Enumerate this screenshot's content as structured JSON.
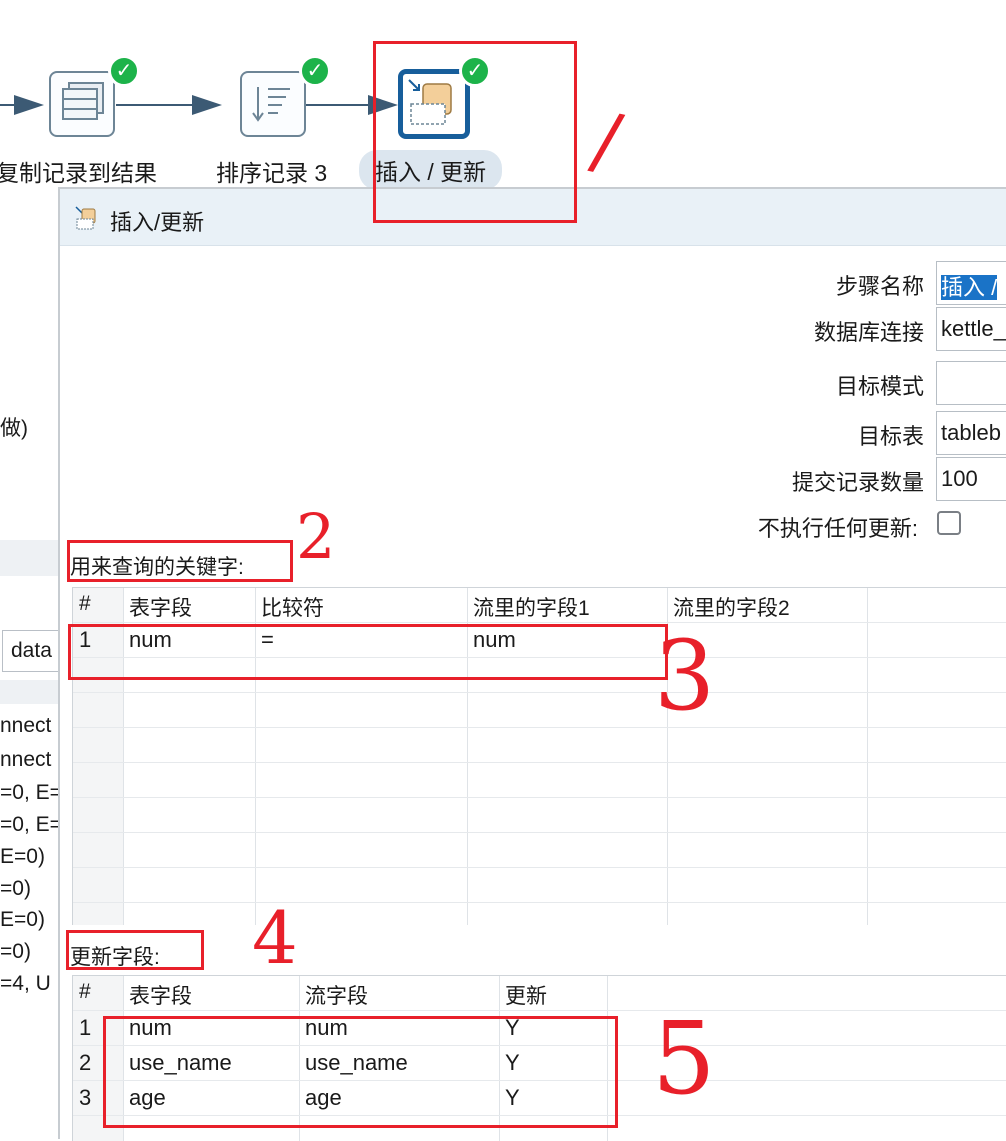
{
  "canvas": {
    "steps": [
      {
        "label": "复制记录到结果"
      },
      {
        "label": "排序记录 3"
      },
      {
        "label": "插入 / 更新"
      }
    ],
    "background_log": [
      "做)",
      "data",
      "nnect",
      "nnect",
      "=0, E=",
      "=0, E=",
      " E=0)",
      "=0)",
      " E=0)",
      "=0)",
      "=4, U"
    ]
  },
  "dialog": {
    "title": "插入/更新",
    "fields": {
      "step_name": {
        "label": "步骤名称",
        "value": "插入 / "
      },
      "db_connection": {
        "label": "数据库连接",
        "value": "kettle_"
      },
      "target_schema": {
        "label": "目标模式",
        "value": ""
      },
      "target_table": {
        "label": "目标表",
        "value": "tableb"
      },
      "commit_size": {
        "label": "提交记录数量",
        "value": "100"
      },
      "no_update": {
        "label": "不执行任何更新:",
        "checked": false
      }
    },
    "key_section": {
      "title": "用来查询的关键字:",
      "columns": [
        "#",
        "表字段",
        "比较符",
        "流里的字段1",
        "流里的字段2"
      ],
      "rows": [
        [
          "1",
          "num",
          "=",
          "num",
          ""
        ]
      ]
    },
    "update_section": {
      "title": "更新字段:",
      "columns": [
        "#",
        "表字段",
        "流字段",
        "更新"
      ],
      "rows": [
        [
          "1",
          "num",
          "num",
          "Y"
        ],
        [
          "2",
          "use_name",
          "use_name",
          "Y"
        ],
        [
          "3",
          "age",
          "age",
          "Y"
        ]
      ]
    }
  },
  "annotations": [
    "/",
    "2",
    "3",
    "4",
    "5"
  ],
  "colors": {
    "annotation": "#e8202a",
    "check": "#1db34a",
    "selected_step": "#175e9b"
  }
}
